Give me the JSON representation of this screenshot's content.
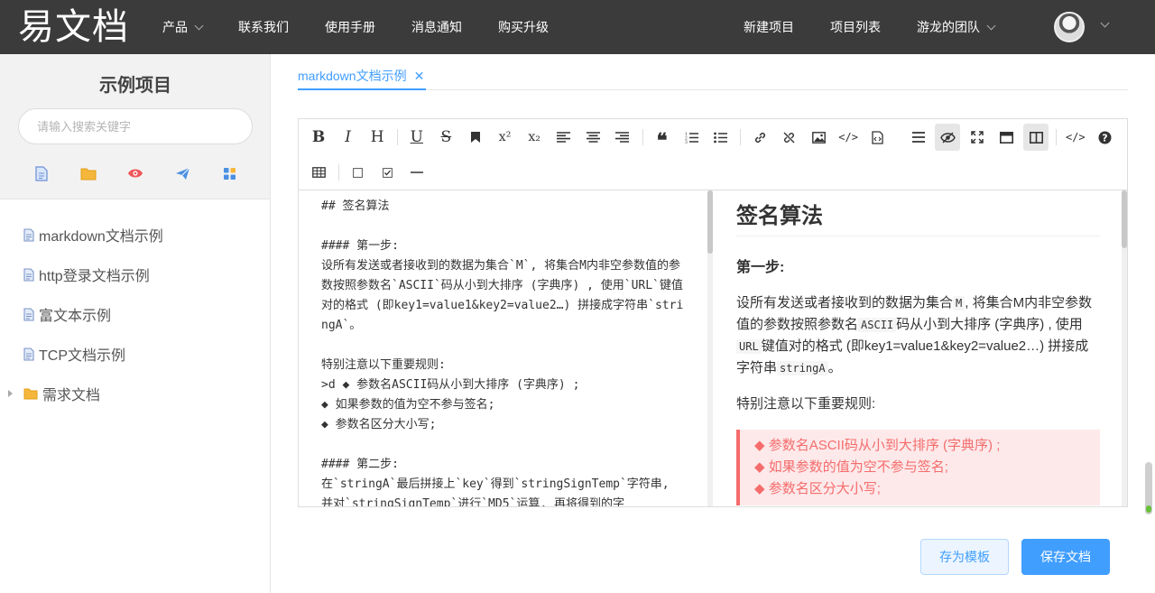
{
  "header": {
    "logo": "易文档",
    "nav_left": [
      {
        "label": "产品",
        "dropdown": true
      },
      {
        "label": "联系我们"
      },
      {
        "label": "使用手册"
      },
      {
        "label": "消息通知"
      },
      {
        "label": "购买升级"
      }
    ],
    "nav_right": [
      {
        "label": "新建项目"
      },
      {
        "label": "项目列表"
      },
      {
        "label": "游龙的团队",
        "dropdown": true
      }
    ]
  },
  "sidebar": {
    "project_title": "示例项目",
    "search_placeholder": "请输入搜索关键字",
    "tools": [
      "doc-icon",
      "folder-icon",
      "eye-icon",
      "send-icon",
      "apps-icon"
    ],
    "tree": [
      {
        "label": "markdown文档示例",
        "icon": "doc-icon"
      },
      {
        "label": "http登录文档示例",
        "icon": "doc-icon"
      },
      {
        "label": "富文本示例",
        "icon": "doc-icon"
      },
      {
        "label": "TCP文档示例",
        "icon": "doc-icon"
      },
      {
        "label": "需求文档",
        "icon": "folder-icon",
        "collapsed": true
      }
    ]
  },
  "tabs": [
    {
      "label": "markdown文档示例",
      "active": true
    }
  ],
  "editor": {
    "source": "## 签名算法\n\n#### 第一步:\n设所有发送或者接收到的数据为集合`M`, 将集合M内非空参数值的参数按照参数名`ASCII`码从小到大排序 (字典序) , 使用`URL`键值对的格式 (即key1=value1&key2=value2…) 拼接成字符串`stringA`。\n\n特别注意以下重要规则:\n>d ◆ 参数名ASCII码从小到大排序 (字典序) ;\n◆ 如果参数的值为空不参与签名;\n◆ 参数名区分大小写;\n\n#### 第二步:\n在`stringA`最后拼接上`key`得到`stringSignTemp`字符串, 并对`stringSignTemp`进行`MD5`运算, 再将得到的字",
    "preview": {
      "h2": "签名算法",
      "h4": "第一步:",
      "p1_a": "设所有发送或者接收到的数据为集合",
      "p1_code1": "M",
      "p1_b": ", 将集合M内非空参数值的参数按照参数名",
      "p1_code2": "ASCII",
      "p1_c": "码从小到大排序 (字典序) , 使用",
      "p1_code3": "URL",
      "p1_d": "键值对的格式 (即key1=value1&key2=value2…) 拼接成字符串",
      "p1_code4": "stringA",
      "p1_e": "。",
      "p2": "特别注意以下重要规则:",
      "note": [
        "◆ 参数名ASCII码从小到大排序 (字典序) ;",
        "◆ 如果参数的值为空不参与签名;",
        "◆ 参数名区分大小写;"
      ]
    }
  },
  "buttons": {
    "save_template": "存为模板",
    "save_doc": "保存文档"
  },
  "colors": {
    "header_bg": "#3b3b3b",
    "accent": "#409eff",
    "note": "#f56c6c"
  }
}
